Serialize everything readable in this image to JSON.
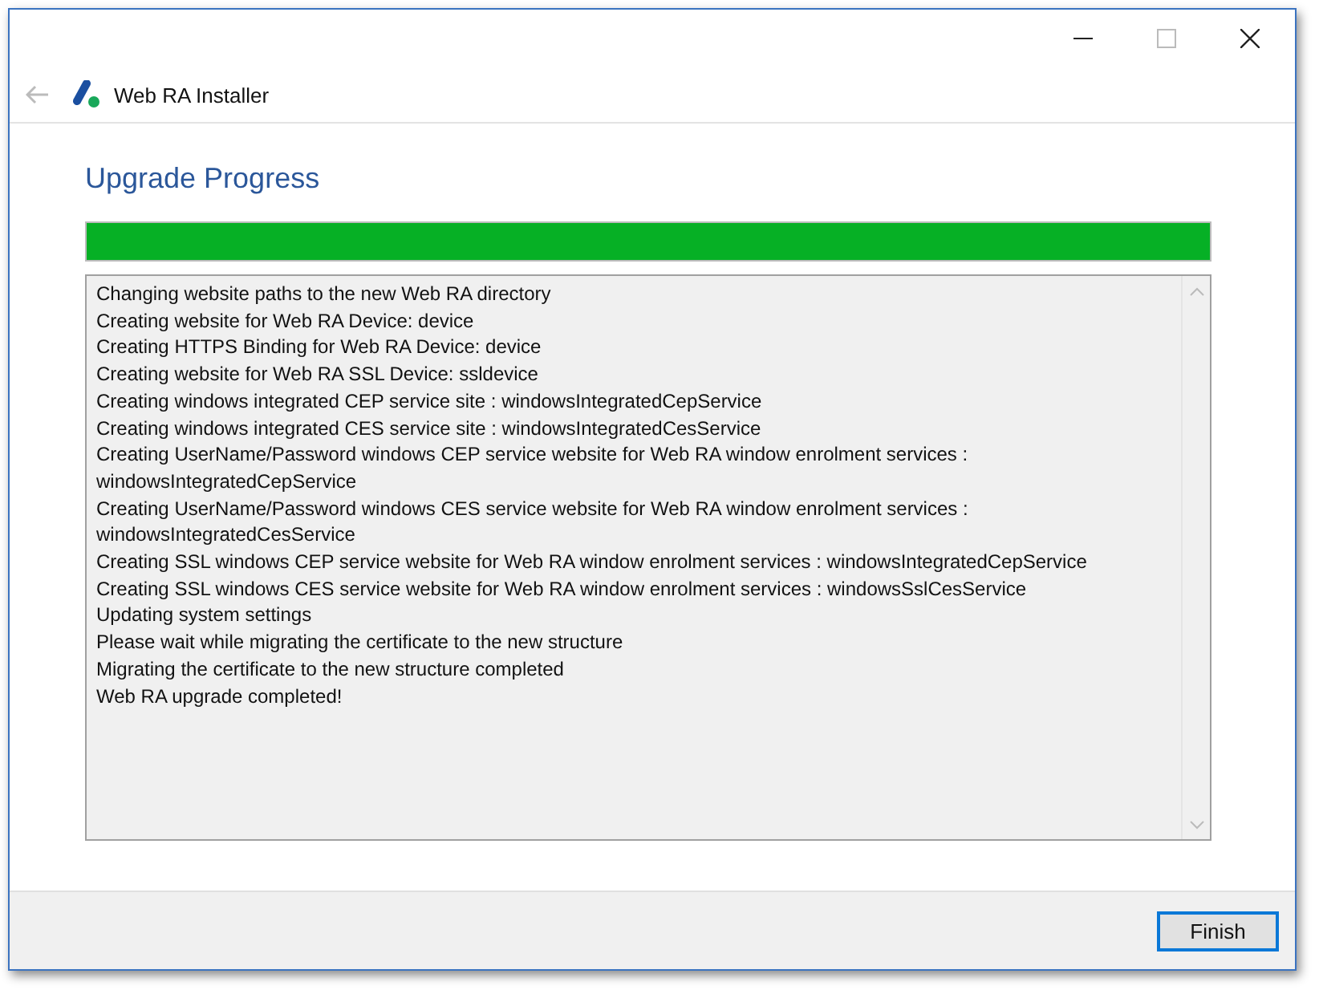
{
  "window": {
    "title": "Web RA Installer"
  },
  "heading": "Upgrade Progress",
  "progress": {
    "level": 1
  },
  "log": [
    "Changing website paths to the new Web RA directory",
    "Creating website for Web RA Device: device",
    "Creating HTTPS Binding for Web RA Device: device",
    "Creating website for Web RA SSL Device: ssldevice",
    "Creating windows integrated CEP service site : windowsIntegratedCepService",
    "Creating windows integrated CES service site : windowsIntegratedCesService",
    "Creating UserName/Password windows CEP service website for Web RA window enrolment services : windowsIntegratedCepService",
    "Creating UserName/Password windows CES service website for Web RA window enrolment services : windowsIntegratedCesService",
    "Creating SSL windows CEP service website for Web RA window enrolment services : windowsIntegratedCepService",
    "Creating SSL windows CES service website for Web RA window enrolment services : windowsSslCesService",
    "Updating system settings",
    "Please wait while migrating the certificate to the new structure",
    "Migrating the certificate to the new structure completed",
    "Web RA upgrade completed!"
  ],
  "buttons": [
    "Finish"
  ]
}
